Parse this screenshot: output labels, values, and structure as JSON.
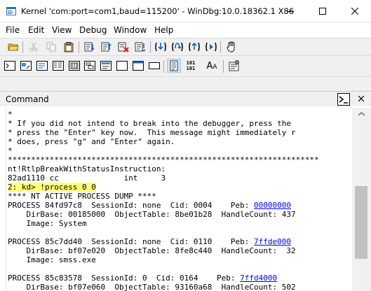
{
  "window": {
    "title": "Kernel 'com:port=com1,baud=115200' - WinDbg:10.0.18362.1 X86"
  },
  "menu": [
    "File",
    "Edit",
    "View",
    "Debug",
    "Window",
    "Help"
  ],
  "toolbar2": {
    "source_label": "101\n101",
    "font_label": "A",
    "font_label_small": "A"
  },
  "panel": {
    "title": "Command"
  },
  "command_output": {
    "lines": [
      "*",
      "* If you did not intend to break into the debugger, press the",
      "* press the \"Enter\" key now.  This message might immediately r",
      "* does, press \"g\" and \"Enter\" again.",
      "*",
      "*******************************************************************",
      "nt!RtlpBreakWithStatusInstruction:",
      "82ad1110 cc              int     3",
      "",
      "**** NT ACTIVE PROCESS DUMP ****",
      "",
      "    DirBase: 00185000  ObjectTable: 8be01b28  HandleCount: 437",
      "    Image: System",
      "",
      "",
      "    DirBase: bf07e020  ObjectTable: 8fe8c440  HandleCount:  32",
      "    Image: smss.exe",
      "",
      "",
      "    DirBase: bf07e060  ObjectTable: 93160a68  HandleCount: 502"
    ],
    "prompt": "2: kd> !process 0 0",
    "processes": [
      {
        "text": "PROCESS 84fd97c8  SessionId: none  Cid: 0004    Peb: ",
        "peb": "00000000"
      },
      {
        "text": "PROCESS 85c7dd40  SessionId: none  Cid: 0110    Peb: ",
        "peb": "7ffde000"
      },
      {
        "text": "PROCESS 85c83578  SessionId: 0  Cid: 0164    Peb: ",
        "peb": "7ffd4000"
      }
    ]
  }
}
